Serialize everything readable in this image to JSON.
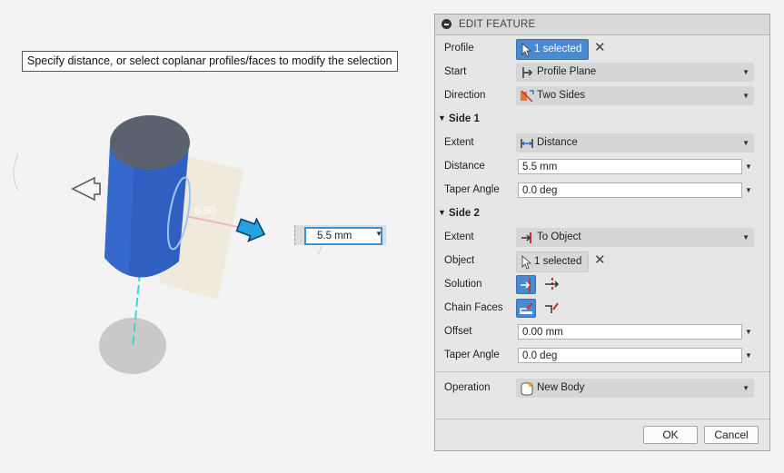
{
  "tooltip": "Specify distance, or select coplanar profiles/faces to modify the selection",
  "viewport": {
    "ghost_dimension": "6.50",
    "distance_input": "5.5 mm"
  },
  "panel": {
    "title": "EDIT FEATURE",
    "profile": {
      "label": "Profile",
      "value": "1 selected"
    },
    "start": {
      "label": "Start",
      "value": "Profile Plane"
    },
    "direction": {
      "label": "Direction",
      "value": "Two Sides"
    },
    "side1": {
      "title": "Side 1",
      "extent": {
        "label": "Extent",
        "value": "Distance"
      },
      "distance": {
        "label": "Distance",
        "value": "5.5 mm"
      },
      "taper": {
        "label": "Taper Angle",
        "value": "0.0 deg"
      }
    },
    "side2": {
      "title": "Side 2",
      "extent": {
        "label": "Extent",
        "value": "To Object"
      },
      "object": {
        "label": "Object",
        "value": "1 selected"
      },
      "solution": {
        "label": "Solution"
      },
      "chain_faces": {
        "label": "Chain Faces"
      },
      "offset": {
        "label": "Offset",
        "value": "0.00 mm"
      },
      "taper": {
        "label": "Taper Angle",
        "value": "0.0 deg"
      }
    },
    "operation": {
      "label": "Operation",
      "value": "New Body"
    },
    "ok_label": "OK",
    "cancel_label": "Cancel"
  },
  "colors": {
    "accent": "#4a8ad1",
    "body_blue": "#2e5fc1",
    "top_face": "#5a6270",
    "axis": "#3fd4d4"
  }
}
